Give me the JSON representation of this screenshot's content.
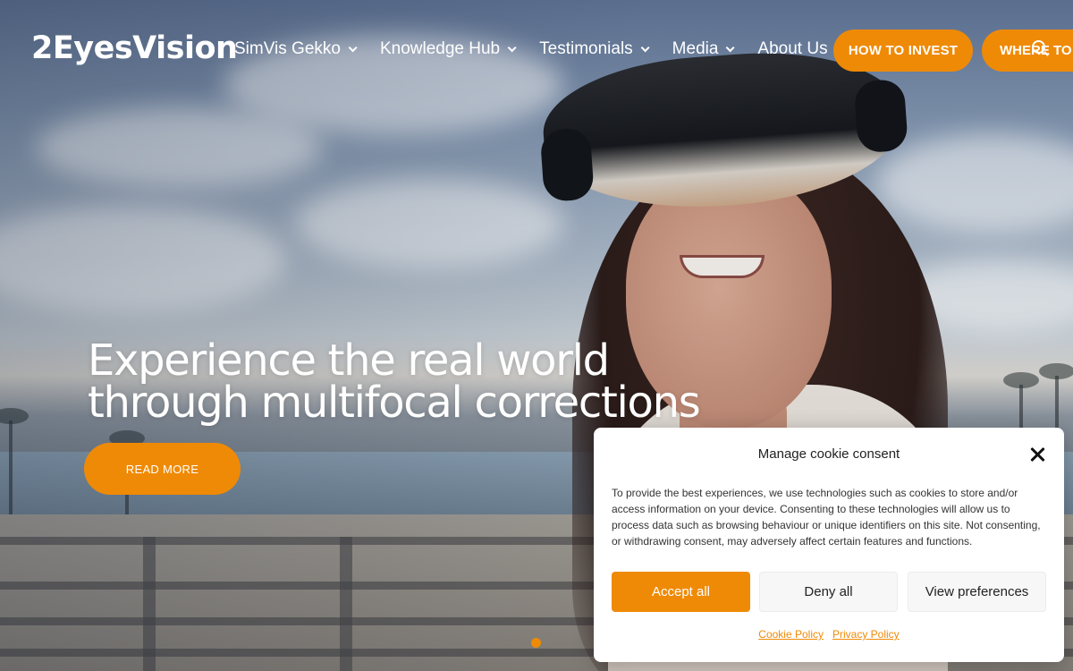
{
  "brand": {
    "logo_text": "2EyesVision",
    "accent_color": "#ef8a06"
  },
  "nav": {
    "items": [
      {
        "label": "SimVis Gekko"
      },
      {
        "label": "Knowledge Hub"
      },
      {
        "label": "Testimonials"
      },
      {
        "label": "Media"
      },
      {
        "label": "About Us"
      }
    ],
    "cta_invest": "HOW TO INVEST",
    "cta_where": "WHERE TO B",
    "search_icon": "search-icon"
  },
  "hero": {
    "headline_line1": "Experience the real world",
    "headline_line2": "through multifocal corrections",
    "read_more": "READ MORE",
    "slide_count": 1,
    "active_slide": 1
  },
  "cookie": {
    "title": "Manage cookie consent",
    "body": "To provide the best experiences, we use technologies such as cookies to store and/or access information on your device. Consenting to these technologies will allow us to process data such as browsing behaviour or unique identifiers on this site. Not consenting, or withdrawing consent, may adversely affect certain features and functions.",
    "accept_label": "Accept all",
    "deny_label": "Deny all",
    "prefs_label": "View preferences",
    "links": [
      {
        "label": "Cookie Policy"
      },
      {
        "label": "Privacy Policy"
      }
    ]
  }
}
